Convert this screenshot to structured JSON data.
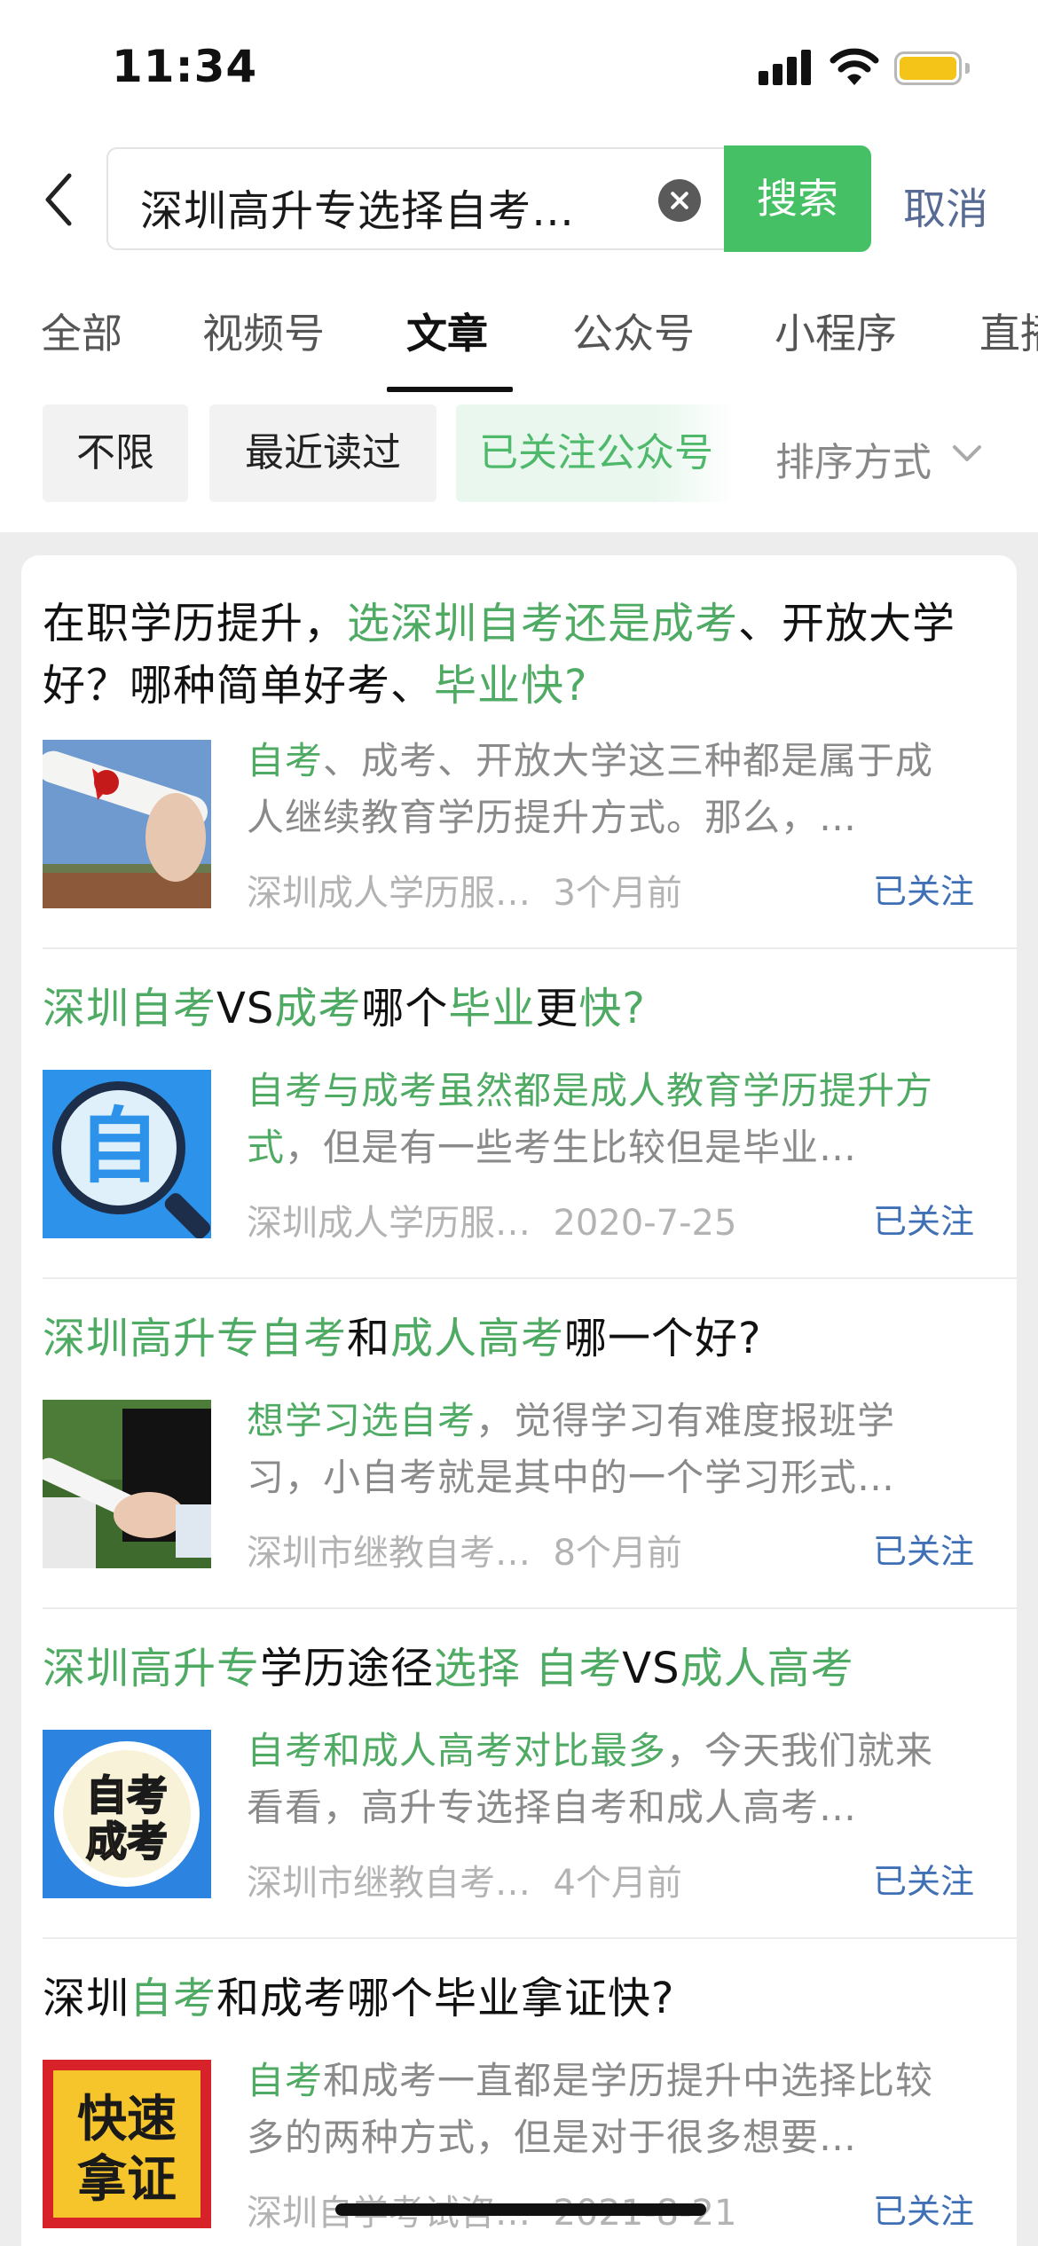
{
  "status_bar": {
    "time": "11:34"
  },
  "search": {
    "query": "深圳高升专选择自考…",
    "search_label": "搜索",
    "cancel_label": "取消"
  },
  "tabs": [
    {
      "label": "全部"
    },
    {
      "label": "视频号"
    },
    {
      "label": "文章",
      "active": true
    },
    {
      "label": "公众号"
    },
    {
      "label": "小程序"
    },
    {
      "label": "直播"
    }
  ],
  "filters": [
    {
      "label": "不限"
    },
    {
      "label": "最近读过"
    },
    {
      "label": "已关注公众号"
    }
  ],
  "sort": {
    "label": "排序方式"
  },
  "colors": {
    "accent_green": "#46c065",
    "highlight_green": "#4fab64",
    "link_blue": "#3f6fb5",
    "cancel_blue": "#576b95",
    "battery": "#f4c419"
  },
  "results": [
    {
      "title_parts": [
        {
          "text": "在职学历提升，",
          "hl": false
        },
        {
          "text": "选深圳自考还是成考",
          "hl": true
        },
        {
          "text": "、开放大学好？哪种简单好考、",
          "hl": false
        },
        {
          "text": "毕业快?",
          "hl": true
        }
      ],
      "snippet_parts": [
        {
          "text": "自考",
          "hl": true
        },
        {
          "text": "、成考、开放大学这三种都是属于成人继续教育学历提升方式。那么，…",
          "hl": false
        }
      ],
      "source": "深圳成人学历服…",
      "date": "3个月前",
      "followed": "已关注",
      "thumb_icon": "diploma-photo"
    },
    {
      "title_parts": [
        {
          "text": "深圳自考",
          "hl": true
        },
        {
          "text": "VS",
          "hl": false
        },
        {
          "text": "成考",
          "hl": true
        },
        {
          "text": "哪个",
          "hl": false
        },
        {
          "text": "毕业",
          "hl": true
        },
        {
          "text": "更",
          "hl": false
        },
        {
          "text": "快?",
          "hl": true
        }
      ],
      "snippet_parts": [
        {
          "text": "自考与成考虽然都是成人教育学历提升方式",
          "hl": true
        },
        {
          "text": "，但是有一些考生比较但是毕业…",
          "hl": false
        }
      ],
      "source": "深圳成人学历服…",
      "date": "2020-7-25",
      "followed": "已关注",
      "thumb_icon": "magnifier-zi-icon",
      "thumb_text": "自"
    },
    {
      "title_parts": [
        {
          "text": "深圳高升专自考",
          "hl": true
        },
        {
          "text": "和",
          "hl": false
        },
        {
          "text": "成人高考",
          "hl": true
        },
        {
          "text": "哪一个好?",
          "hl": false
        }
      ],
      "snippet_parts": [
        {
          "text": "想学习选自考",
          "hl": true
        },
        {
          "text": "，觉得学习有难度报班学习，小自考就是其中的一个学习形式…",
          "hl": false
        }
      ],
      "source": "深圳市继教自考…",
      "date": "8个月前",
      "followed": "已关注",
      "thumb_icon": "graduation-photo"
    },
    {
      "title_parts": [
        {
          "text": "深圳高升专",
          "hl": true
        },
        {
          "text": "学历途径",
          "hl": false
        },
        {
          "text": "选择 自考",
          "hl": true
        },
        {
          "text": "VS",
          "hl": false
        },
        {
          "text": "成人高考",
          "hl": true
        }
      ],
      "snippet_parts": [
        {
          "text": "自考和成人高考对比最多",
          "hl": true
        },
        {
          "text": "，今天我们就来看看，高升专选择自考和成人高考…",
          "hl": false
        }
      ],
      "source": "深圳市继教自考…",
      "date": "4个月前",
      "followed": "已关注",
      "thumb_icon": "zikao-chengkao-badge",
      "thumb_lines": [
        "自考",
        "成考"
      ]
    },
    {
      "title_parts": [
        {
          "text": "深圳",
          "hl": false
        },
        {
          "text": "自考",
          "hl": true
        },
        {
          "text": "和成考哪个毕业拿证快?",
          "hl": false
        }
      ],
      "snippet_parts": [
        {
          "text": "自考",
          "hl": true
        },
        {
          "text": "和成考一直都是学历提升中选择比较多的两种方式，但是对于很多想要…",
          "hl": false
        }
      ],
      "source": "深圳自学考试咨…",
      "date": "2021-8-21",
      "followed": "已关注",
      "thumb_icon": "kuaisu-nazheng-badge",
      "thumb_lines": [
        "快速",
        "拿证"
      ]
    }
  ]
}
